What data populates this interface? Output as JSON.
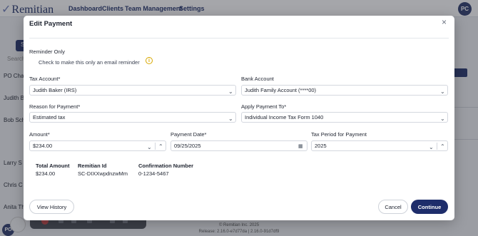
{
  "app": {
    "brand": "Remitian",
    "nav": [
      "Dashboard",
      "Clients",
      "Team Management",
      "Settings"
    ],
    "user_initials": "PC"
  },
  "background": {
    "side_labels": [
      "S",
      "Search",
      "PO Cha",
      "Judith B",
      "Bob Sch",
      "Larry S",
      "Chris C",
      "Anita Th"
    ],
    "side_initials": "PO",
    "footer_copyright": "© Remitian Inc. 2025",
    "footer_release": "Release: 2.16.0-e7d77da | 2.16.0-91d7df9"
  },
  "modal": {
    "title": "Edit Payment",
    "close_label": "×",
    "reminder": {
      "heading": "Reminder Only",
      "checkbox_label": "Check to make this only an email reminder",
      "info_icon": "i"
    },
    "tax_account": {
      "label": "Tax Account*",
      "value": "Judith Baker (IRS)"
    },
    "bank_account": {
      "label": "Bank Account",
      "value": "Judith Family Account (****00)"
    },
    "reason": {
      "label": "Reason for Payment*",
      "value": "Estimated tax"
    },
    "apply_to": {
      "label": "Apply Payment To*",
      "value": "Individual Income Tax Form 1040"
    },
    "amount": {
      "label": "Amount*",
      "value": "$234.00"
    },
    "payment_date": {
      "label": "Payment Date*",
      "value": "09/25/2025"
    },
    "tax_period": {
      "label": "Tax Period for Payment",
      "value": "2025"
    },
    "summary": {
      "total_label": "Total Amount",
      "total_value": "$234.00",
      "remitian_id_label": "Remitian Id",
      "remitian_id_value": "SC-DIXXwpdnzwMm",
      "confirmation_label": "Confirmation Number",
      "confirmation_value": "0-1234-5467"
    },
    "buttons": {
      "view_history": "View History",
      "cancel": "Cancel",
      "continue": "Continue"
    }
  }
}
